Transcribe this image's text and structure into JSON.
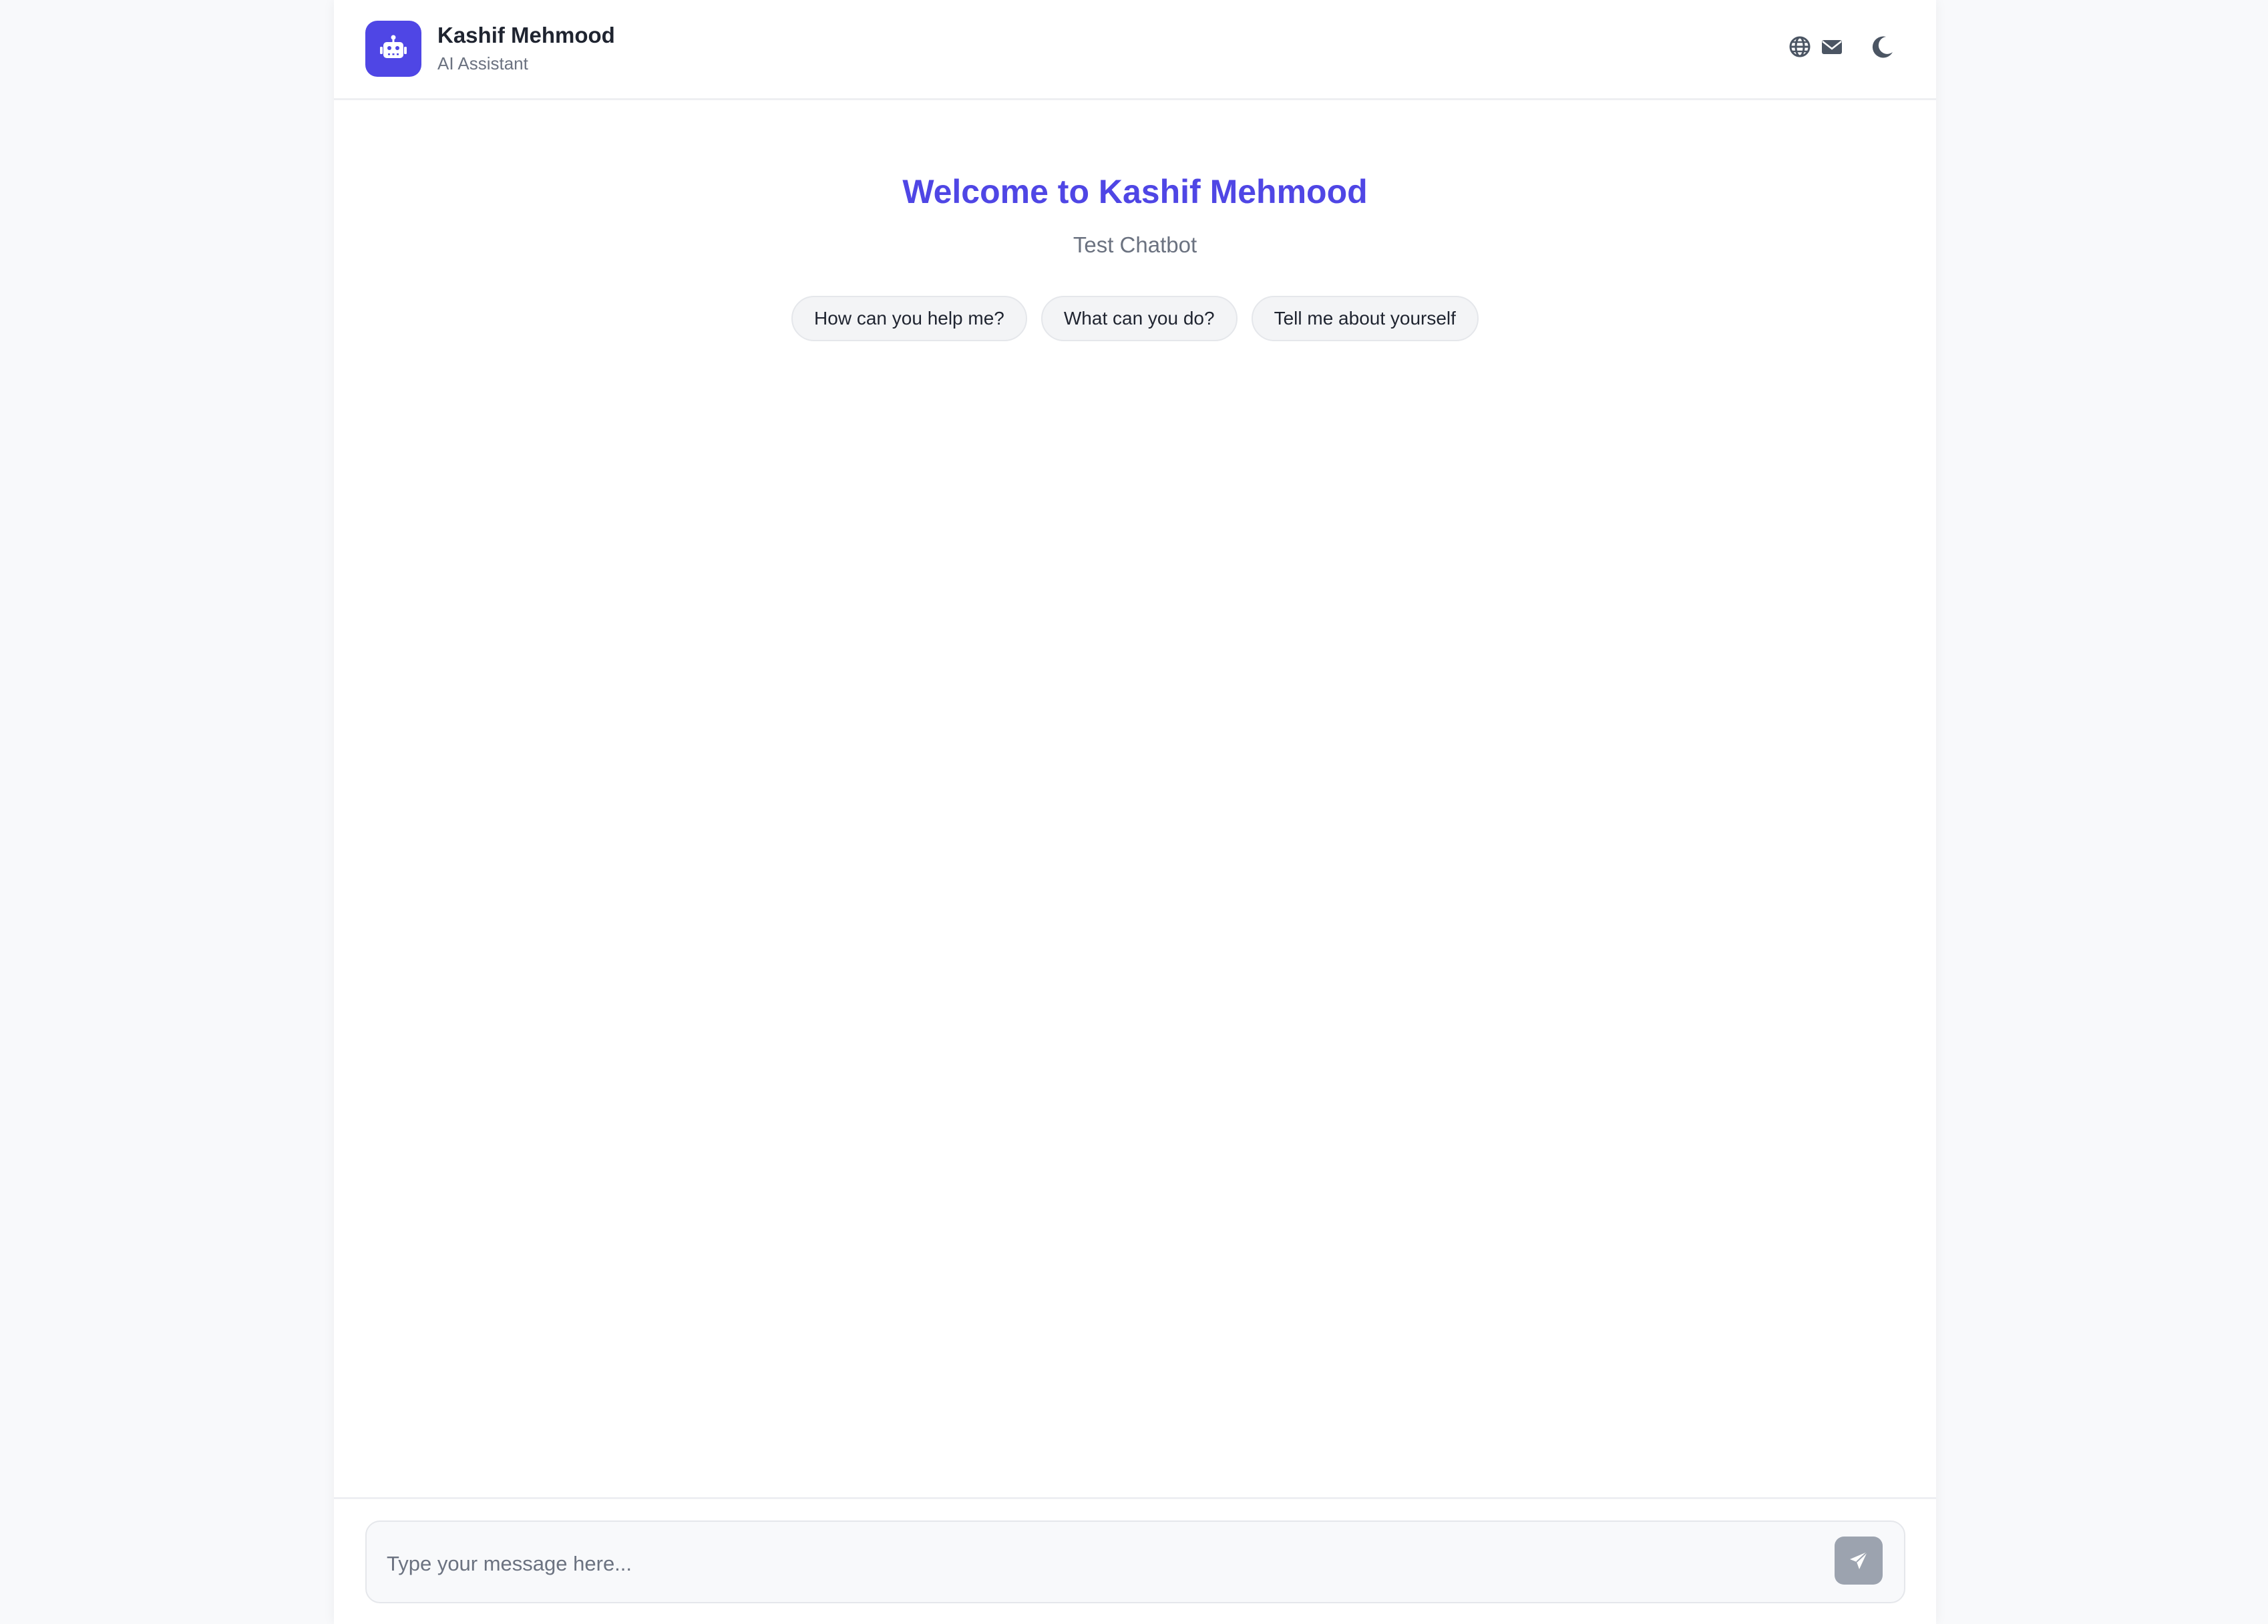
{
  "header": {
    "title": "Kashif Mehmood",
    "subtitle": "AI Assistant",
    "logo_icon": "robot-icon",
    "actions": [
      {
        "icon": "globe-icon"
      },
      {
        "icon": "mail-icon"
      },
      {
        "icon": "moon-icon"
      }
    ]
  },
  "welcome": {
    "title": "Welcome to Kashif Mehmood",
    "subtitle": "Test Chatbot"
  },
  "suggestions": [
    "How can you help me?",
    "What can you do?",
    "Tell me about yourself"
  ],
  "composer": {
    "placeholder": "Type your message here...",
    "value": "",
    "send_icon": "send-icon"
  },
  "colors": {
    "accent": "#4f46e5",
    "muted_text": "#6b7280",
    "send_button": "#9ca3af"
  }
}
